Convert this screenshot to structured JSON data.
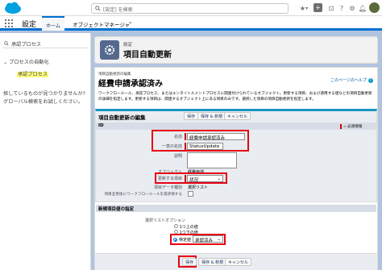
{
  "header": {
    "search_placeholder": "[設定] を検索",
    "icons": [
      "star-icon",
      "chevron-down-icon",
      "add-icon",
      "help-icon",
      "setup-icon",
      "notification-icon",
      "avatar"
    ]
  },
  "nav": {
    "app_name": "設定",
    "tabs": [
      "ホーム",
      "オブジェクトマネージャ"
    ],
    "tab_menu_glyph": "⌄"
  },
  "left": {
    "search_value": "承認プロセス",
    "tree_parent": "プロセスの自動化",
    "tree_child": "承認プロセス",
    "help_line1": "探しているものが見つかりませんか?",
    "help_line2": "グローバル検索をお試しください。"
  },
  "page": {
    "kicker": "設定",
    "title": "項目自動更新"
  },
  "record": {
    "edit_kicker": "項目自動更新の編集",
    "title": "経費申請承認済み",
    "help_link": "このページのヘルプ",
    "description": "ワークフロールール、承認プロセス、またはエンタイトルメントプロセスに関連付けられているオブジェクト。更新する項目、および適用する値などの項目自動更新の詳細を指定します。更新する項目は、関連するオブジェクト上にある項目のみです。選択した項目の項目自動更新を指定します。"
  },
  "edit": {
    "section_title": "項目自動更新の編集",
    "buttons": {
      "save": "保存",
      "save_new": "保存 & 新規",
      "cancel": "キャンセル"
    },
    "id_label": "ID",
    "required_legend": "= 必須情報",
    "name_label": "名前",
    "name_value": "経費申請承認済み",
    "api_label": "一意の名前",
    "api_value": "StatusUpdate",
    "desc_label": "説明",
    "object_label": "オブジェクト",
    "object_value": "経費申請",
    "field_label": "更新する項目",
    "field_value": "状況",
    "datatype_label": "項目データ種別",
    "datatype_value": "選択リスト",
    "reeval_label": "項目変更後にワークフロールールを再評価する"
  },
  "newvalue": {
    "section_title": "新規項目値の指定",
    "option_label": "選択リストオプション",
    "options": [
      "1つ上の値",
      "1つ下の値",
      "特定値"
    ],
    "specific_value": "承認済み"
  }
}
